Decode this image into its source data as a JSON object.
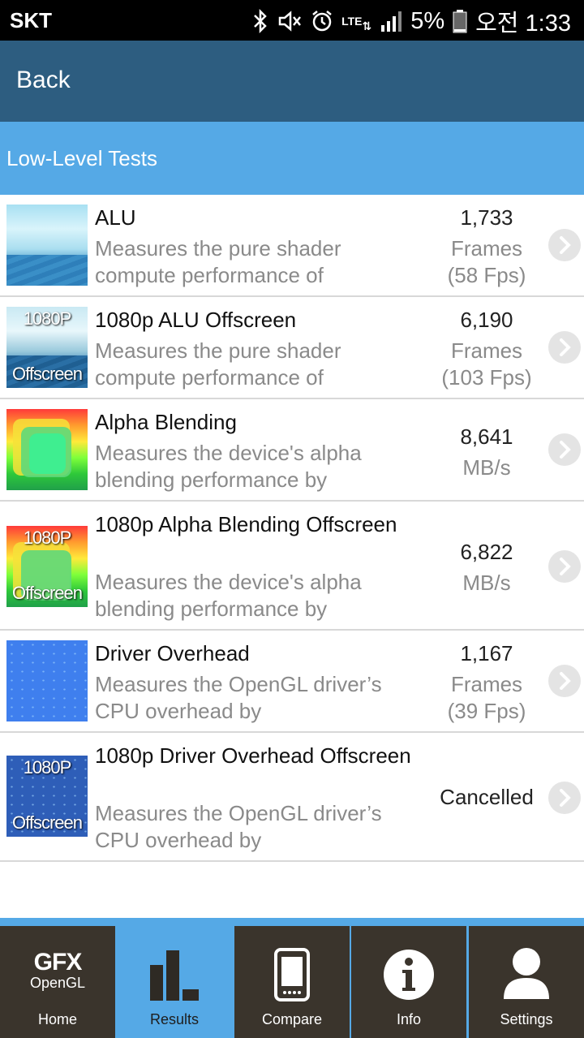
{
  "status_bar": {
    "carrier": "SKT",
    "network": "LTE",
    "battery": "5%",
    "time": "오전 1:33",
    "icons": [
      "bluetooth-icon",
      "mute-icon",
      "alarm-icon",
      "lte-icon",
      "signal-icon",
      "battery-icon"
    ]
  },
  "header": {
    "back_label": "Back"
  },
  "section": {
    "title": "Low-Level Tests"
  },
  "tests": [
    {
      "name": "ALU",
      "description": "Measures the pure shader compute performance of",
      "value": "1,733",
      "unit_line1": "Frames",
      "unit_line2": "(58 Fps)",
      "thumb_top": "",
      "thumb_bottom": ""
    },
    {
      "name": "1080p ALU Offscreen",
      "description": "Measures the pure shader compute performance of",
      "value": "6,190",
      "unit_line1": "Frames",
      "unit_line2": "(103 Fps)",
      "thumb_top": "1080P",
      "thumb_bottom": "Offscreen"
    },
    {
      "name": "Alpha Blending",
      "description": "Measures the device's alpha blending performance by",
      "value": "8,641",
      "unit_line1": "MB/s",
      "thumb_top": "",
      "thumb_bottom": ""
    },
    {
      "name": "1080p Alpha Blending Offscreen",
      "description": "Measures the device's alpha blending performance by",
      "value": "6,822",
      "unit_line1": "MB/s",
      "thumb_top": "1080P",
      "thumb_bottom": "Offscreen"
    },
    {
      "name": "Driver Overhead",
      "description": "Measures the OpenGL driver’s CPU overhead by",
      "value": "1,167",
      "unit_line1": "Frames",
      "unit_line2": "(39 Fps)",
      "thumb_top": "",
      "thumb_bottom": ""
    },
    {
      "name": "1080p Driver Overhead Offscreen",
      "description": "Measures the OpenGL driver’s CPU overhead by",
      "value": "Cancelled",
      "thumb_top": "1080P",
      "thumb_bottom": "Offscreen"
    }
  ],
  "bottom_nav": {
    "logo_big": "GFX",
    "logo_small": "OpenGL",
    "items": [
      {
        "label": "Home",
        "icon": "gfx-logo-icon"
      },
      {
        "label": "Results",
        "icon": "bar-chart-icon",
        "active": true
      },
      {
        "label": "Compare",
        "icon": "phone-icon"
      },
      {
        "label": "Info",
        "icon": "info-icon"
      },
      {
        "label": "Settings",
        "icon": "user-icon"
      }
    ]
  },
  "colors": {
    "app_bar": "#2d5d80",
    "section_bar": "#55a9e6",
    "nav_bg": "#3a342c",
    "nav_active": "#55a9e6"
  }
}
